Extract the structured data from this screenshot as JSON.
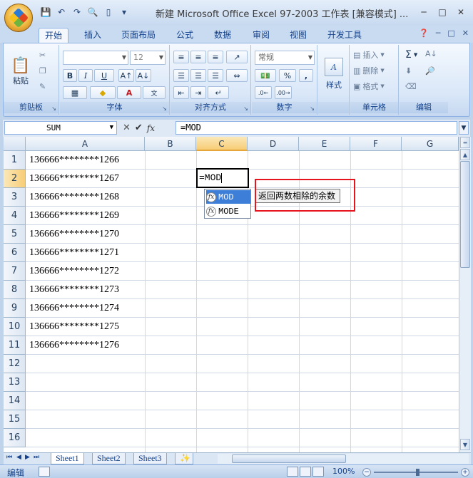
{
  "title": "新建 Microsoft Office Excel 97-2003 工作表 [兼容模式] ...",
  "quick_access": {
    "icons": [
      "save-icon",
      "undo-icon",
      "redo-icon",
      "print-preview-icon",
      "new-doc-icon"
    ]
  },
  "tabs": [
    "开始",
    "插入",
    "页面布局",
    "公式",
    "数据",
    "审阅",
    "视图",
    "开发工具"
  ],
  "active_tab": "开始",
  "ribbon": {
    "clipboard": {
      "label": "剪贴板",
      "paste": "粘贴"
    },
    "font": {
      "label": "字体",
      "size": "12",
      "bold": "B",
      "italic": "I",
      "underline": "U"
    },
    "alignment": {
      "label": "对齐方式"
    },
    "number": {
      "label": "数字",
      "format": "常规",
      "percent": "%",
      "comma": ","
    },
    "styles": {
      "label": "样式"
    },
    "cells": {
      "label": "单元格",
      "insert": "插入",
      "delete": "删除",
      "format": "格式"
    },
    "editing": {
      "label": "编辑",
      "sigma": "Σ"
    }
  },
  "formula_bar": {
    "name_box": "SUM",
    "fx": "fx",
    "formula": "=MOD"
  },
  "columns": [
    "A",
    "B",
    "C",
    "D",
    "E",
    "F",
    "G"
  ],
  "active_column": "C",
  "rows": [
    "1",
    "2",
    "3",
    "4",
    "5",
    "6",
    "7",
    "8",
    "9",
    "10",
    "11",
    "12",
    "13",
    "14",
    "15",
    "16"
  ],
  "active_row": "2",
  "column_a_values": [
    "136666********1266",
    "136666********1267",
    "136666********1268",
    "136666********1269",
    "136666********1270",
    "136666********1271",
    "136666********1272",
    "136666********1273",
    "136666********1274",
    "136666********1275",
    "136666********1276"
  ],
  "active_cell_text": "=MOD",
  "autocomplete": [
    "MOD",
    "MODE"
  ],
  "tooltip": "返回两数相除的余数",
  "sheets": [
    "Sheet1",
    "Sheet2",
    "Sheet3"
  ],
  "active_sheet": "Sheet1",
  "status": {
    "mode": "编辑",
    "zoom": "100%"
  },
  "colors": {
    "accent": "#3d7fd8",
    "highlight": "#e8141d",
    "selected_header": "#f7cd76"
  }
}
